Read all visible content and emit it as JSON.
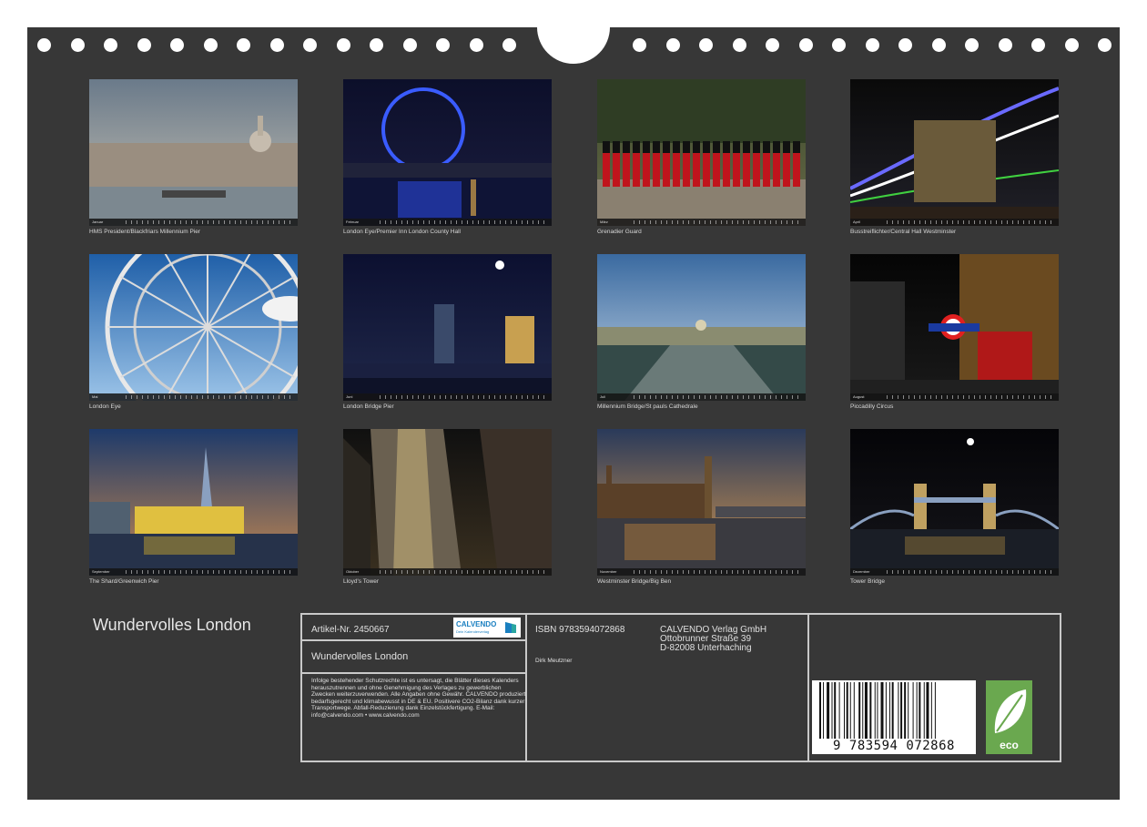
{
  "calendar_title": "Wundervolles London",
  "months": [
    {
      "month": "Januar",
      "caption": "HMS President/Blackfriars Millennium Pier"
    },
    {
      "month": "Februar",
      "caption": "London Eye/Premier Inn London County Hall"
    },
    {
      "month": "März",
      "caption": "Grenadier Guard"
    },
    {
      "month": "April",
      "caption": "Busstreiflichter/Central Hall Westminster"
    },
    {
      "month": "Mai",
      "caption": "London Eye"
    },
    {
      "month": "Juni",
      "caption": "London Bridge Pier"
    },
    {
      "month": "Juli",
      "caption": "Millennium Bridge/St pauls Cathedrale"
    },
    {
      "month": "August",
      "caption": "Piccadilly Circus"
    },
    {
      "month": "September",
      "caption": "The Shard/Greenwich Pier"
    },
    {
      "month": "Oktober",
      "caption": "Lloyd's Tower"
    },
    {
      "month": "November",
      "caption": "Westminster Bridge/Big Ben"
    },
    {
      "month": "Dezember",
      "caption": "Tower Bridge"
    }
  ],
  "info": {
    "article": "Artikel-Nr. 2450667",
    "title": "Wundervolles London",
    "legal": "Infolge bestehender Schutzrechte ist es untersagt, die Blätter dieses Kalenders herauszutrennen und ohne Genehmigung des Verlages zu gewerblichen Zwecken weiterzuverwenden. Alle Angaben ohne Gewähr. CALVENDO produziert bedarfsgerecht und klimabewusst in DE & EU. Positivere CO2-Bilanz dank kurzer Transportwege. Abfall-Reduzierung dank Einzelstückfertigung. E-Mail: info@calvendo.com • www.calvendo.com",
    "isbn": "ISBN 9783594072868",
    "author": "Dirk Meutzner",
    "publisher_name": "CALVENDO Verlag GmbH",
    "publisher_street": "Ottobrunner Straße 39",
    "publisher_city": "D-82008 Unterhaching",
    "barcode_digits": "9 783594 072868",
    "logo_word": "CALVENDO",
    "logo_tag": "Dein Kalenderverlag",
    "eco_label": "eco"
  },
  "colors": {
    "sheet": "#373737",
    "border": "#c9c9c9",
    "eco_green": "#6aa84f",
    "calvendo_blue": "#1a7fc0"
  }
}
